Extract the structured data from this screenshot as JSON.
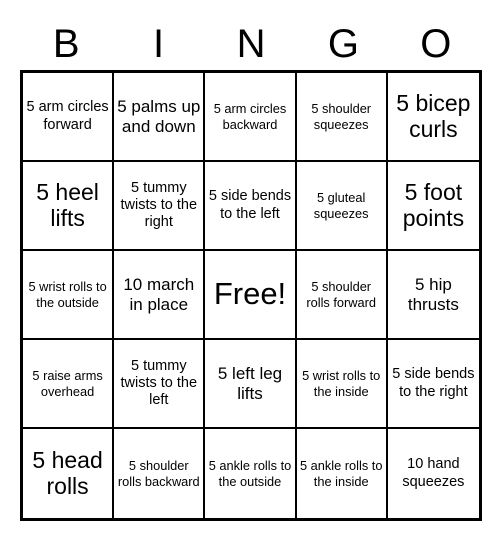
{
  "header": {
    "letters": [
      "B",
      "I",
      "N",
      "G",
      "O"
    ]
  },
  "grid": {
    "rows": 5,
    "columns": 5,
    "cells": [
      {
        "text": "5 arm circles forward",
        "size": "sm"
      },
      {
        "text": "5 palms up and down",
        "size": "md"
      },
      {
        "text": "5 arm circles backward",
        "size": "xs"
      },
      {
        "text": "5 shoulder squeezes",
        "size": "xs"
      },
      {
        "text": "5 bicep curls",
        "size": "lg"
      },
      {
        "text": "5 heel lifts",
        "size": "lg"
      },
      {
        "text": "5 tummy twists to the right",
        "size": "sm"
      },
      {
        "text": "5 side bends to the left",
        "size": "sm"
      },
      {
        "text": "5 gluteal squeezes",
        "size": "xs"
      },
      {
        "text": "5 foot points",
        "size": "lg"
      },
      {
        "text": "5 wrist rolls to the outside",
        "size": "xs"
      },
      {
        "text": "10 march in place",
        "size": "md"
      },
      {
        "text": "Free!",
        "size": "xl"
      },
      {
        "text": "5 shoulder rolls forward",
        "size": "xs"
      },
      {
        "text": "5 hip thrusts",
        "size": "md"
      },
      {
        "text": "5 raise arms overhead",
        "size": "xs"
      },
      {
        "text": "5 tummy twists to the left",
        "size": "sm"
      },
      {
        "text": "5 left leg lifts",
        "size": "md"
      },
      {
        "text": "5 wrist rolls to the inside",
        "size": "xs"
      },
      {
        "text": "5 side bends to the right",
        "size": "sm"
      },
      {
        "text": "5 head rolls",
        "size": "lg"
      },
      {
        "text": "5 shoulder rolls backward",
        "size": "xs"
      },
      {
        "text": "5 ankle rolls to the outside",
        "size": "xs"
      },
      {
        "text": "5 ankle rolls to the inside",
        "size": "xs"
      },
      {
        "text": "10 hand squeezes",
        "size": "sm"
      }
    ]
  },
  "colors": {
    "border": "#000000",
    "background": "#ffffff",
    "text": "#000000"
  }
}
